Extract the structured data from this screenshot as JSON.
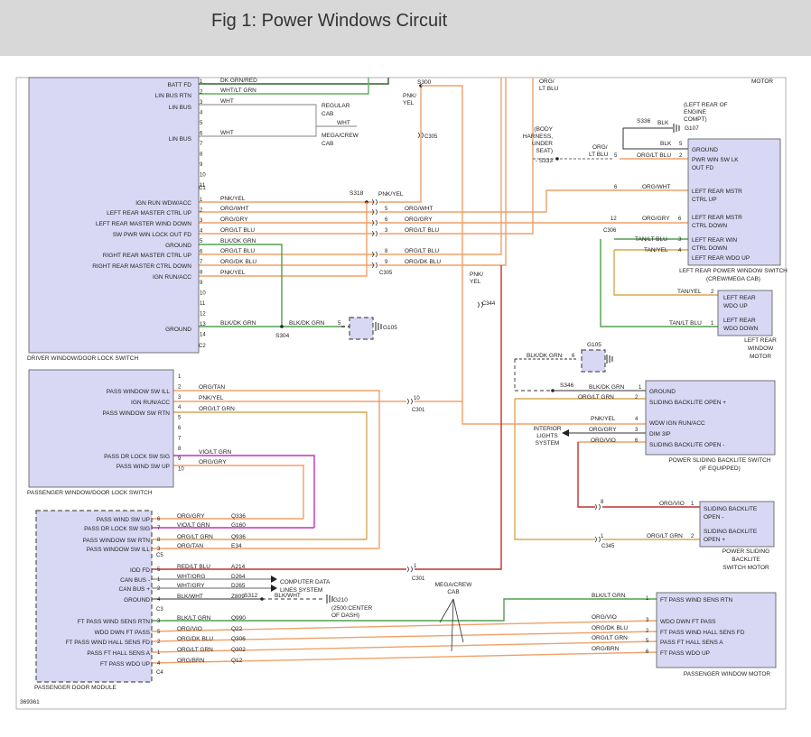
{
  "header": {
    "title": "Fig 1: Power Windows Circuit"
  },
  "figure_id": "369361",
  "modules": [
    {
      "id": "dw",
      "name": "DRIVER WINDOW/DOOR LOCK SWITCH",
      "fill": "#d8d8f4"
    },
    {
      "id": "pw",
      "name": "PASSENGER WINDOW/DOOR LOCK SWITCH",
      "fill": "#d8d8f4"
    },
    {
      "id": "pdm",
      "name": "PASSENGER DOOR MODULE",
      "fill": "#d8d8f4"
    },
    {
      "id": "lrs",
      "name": "LEFT REAR POWER WINDOW SWITCH",
      "sub": "(CREW/MEGA CAB)",
      "fill": "#d8d8f4"
    },
    {
      "id": "lrm",
      "name": "LEFT REAR WINDOW MOTOR",
      "fill": "#d8d8f4"
    },
    {
      "id": "psb",
      "name": "POWER SLIDING BACKLITE SWITCH",
      "sub": "(IF EQUIPPED)",
      "fill": "#d8d8f4"
    },
    {
      "id": "psm",
      "name": "POWER SLIDING BACKLITE SWITCH MOTOR",
      "fill": "#d8d8f4"
    },
    {
      "id": "pwm",
      "name": "PASSENGER WINDOW MOTOR",
      "fill": "#d8d8f4"
    }
  ],
  "colors": {
    "orange": "#f0a068",
    "green": "#50a050",
    "tan": "#d8a850",
    "purple": "#c030c0",
    "red": "#c03030",
    "darkgreen": "#306030",
    "gray": "#808080",
    "black": "#303030",
    "ltgreen": "#60b060"
  },
  "labels": {
    "dw_pins": [
      "BATT FD",
      "LIN BUS RTN",
      "LIN BUS",
      "LIN BUS",
      "IGN RUN WDW/ACC",
      "LEFT REAR MASTER CTRL UP",
      "LEFT REAR MASTER WIND DOWN",
      "SW PWR WIN LOCK OUT FD",
      "GROUND",
      "RIGHT REAR MASTER CTRL UP",
      "RIGHT REAR MASTER CTRL DOWN",
      "IGN RUN/ACC",
      "GROUND"
    ],
    "dw_c1_wires": [
      "DK GRN/RED",
      "WHT/LT GRN",
      "WHT",
      "WHT"
    ],
    "dw_c2_wires": [
      "PNK/YEL",
      "ORG/WHT",
      "ORG/GRY",
      "ORG/LT BLU",
      "BLK/DK GRN",
      "ORG/LT BLU",
      "ORG/DK BLU",
      "PNK/YEL",
      "BLK/DK GRN"
    ],
    "c305_wires": [
      "PNK/YEL",
      "ORG/WHT",
      "ORG/GRY",
      "ORG/LT BLU",
      "ORG/LT BLU",
      "ORG/DK BLU"
    ],
    "regular_cab": [
      "REGULAR",
      "CAB"
    ],
    "mega_cab": [
      "MEGA/CREW",
      "CAB"
    ],
    "splices": [
      "S300",
      "S318",
      "S304",
      "S336",
      "S333",
      "S346",
      "S312"
    ],
    "connectors": [
      "C1",
      "C2",
      "C305",
      "C301",
      "C306",
      "C344",
      "C345",
      "C3",
      "C4",
      "C5"
    ],
    "grounds": [
      "G105",
      "G105",
      "G107",
      "G210"
    ],
    "g107_note": [
      "(LEFT REAR OF",
      "ENGINE",
      "COMPT)"
    ],
    "g210_note": [
      "(2500:CENTER",
      "OF DASH)"
    ],
    "body_harness": [
      "(BODY",
      "HARNESS,",
      "UNDER",
      "SEAT)"
    ],
    "org_lt_blu_top": [
      "ORG/",
      "LT BLU"
    ],
    "pnk_yel_top": [
      "PNK/",
      "YEL"
    ],
    "pnk_yel_mid": [
      "PNK/",
      "YEL"
    ],
    "motor_top": "MOTOR",
    "lrs_pins": [
      "GROUND",
      "PWR WIN SW LK",
      "OUT FD",
      "LEFT REAR MSTR",
      "CTRL UP",
      "LEFT REAR MSTR",
      "CTRL DOWN",
      "LEFT REAR WIN",
      "CTRL DOWN",
      "LEFT REAR WDO UP"
    ],
    "lrs_wires": [
      "BLK",
      "ORG/LT BLU",
      "ORG/WHT",
      "ORG/GRY",
      "TAN/LT BLU",
      "TAN/YEL",
      "BLK",
      "ORG/",
      "LT BLU"
    ],
    "lrm_pins": [
      "LEFT REAR",
      "WDO UP",
      "LEFT REAR",
      "WDO DOWN"
    ],
    "lrm_wires": [
      "TAN/YEL",
      "TAN/LT BLU"
    ],
    "lrm_name": [
      "LEFT REAR",
      "WINDOW",
      "MOTOR"
    ],
    "pw_pins": [
      "PASS WINDOW SW ILL",
      "IGN RUN/ACC",
      "PASS WINDOW SW RTN",
      "PASS DR LOCK SW SIG",
      "PASS WIND SW UP"
    ],
    "pw_wires": [
      "ORG/TAN",
      "PNK/YEL",
      "ORG/LT GRN",
      "VIO/LT GRN",
      "ORG/GRY"
    ],
    "psb_pins": [
      "GROUND",
      "SLIDING BACKLITE OPEN +",
      "WDW IGN RUN/ACC",
      "DIM 3IP",
      "SLIDING BACKLITE OPEN -"
    ],
    "psb_wires": [
      "BLK/DK GRN",
      "ORG/LT GRN",
      "PNK/YEL",
      "ORG/GRY",
      "ORG/VIO",
      "BLK/DK GRN"
    ],
    "interior": [
      "INTERIOR",
      "LIGHTS",
      "SYSTEM"
    ],
    "psm_pins": [
      "SLIDING BACKLITE",
      "OPEN -",
      "SLIDING BACKLITE",
      "OPEN +"
    ],
    "psm_wires": [
      "ORG/VIO",
      "ORG/LT GRN"
    ],
    "psm_name": [
      "POWER SLIDING",
      "BACKLITE",
      "SWITCH MOTOR"
    ],
    "pdm_pins": [
      "PASS WIND SW UP",
      "PASS DR LOCK SW SIG",
      "PASS WINDOW SW RTN",
      "PASS WINDOW SW ILL",
      "IOD FD",
      "CAN BUS -",
      "CAN BUS +",
      "GROUND",
      "FT PASS WIND SENS RTN",
      "WDO DWN FT PASS",
      "FT PASS WIND HALL SENS FD",
      "PASS FT HALL SENS A",
      "FT PASS WDO UP"
    ],
    "pdm_wires": [
      "ORG/GRY",
      "VIO/LT GRN",
      "ORG/LT GRN",
      "ORG/TAN",
      "RED/LT BLU",
      "WHT/ORG",
      "WHT/GRY",
      "BLK/WHT",
      "BLK/LT GRN",
      "ORG/VIO",
      "ORG/DK BLU",
      "ORG/LT GRN",
      "ORG/BRN"
    ],
    "pdm_circuits": [
      "Q336",
      "G160",
      "Q936",
      "E34",
      "A214",
      "D264",
      "D265",
      "Z809",
      "Q990",
      "Q22",
      "Q306",
      "Q302",
      "Q12"
    ],
    "blk_wht": "BLK/WHT",
    "computer": [
      "COMPUTER DATA",
      "LINES SYSTEM"
    ],
    "mega_crew_cab2": [
      "MEGA/CREW",
      "CAB"
    ],
    "pwm_pins": [
      "FT PASS WIND SENS RTN",
      "WDO DWN FT PASS",
      "FT PASS WIND HALL SENS FD",
      "PASS FT HALL SENS A",
      "FT PASS WDO UP"
    ],
    "pwm_wires": [
      "BLK/LT GRN",
      "ORG/VIO",
      "ORG/DK BLU",
      "ORG/LT GRN",
      "ORG/BRN"
    ],
    "c344_wires": [
      "PNK/",
      "YEL"
    ]
  }
}
